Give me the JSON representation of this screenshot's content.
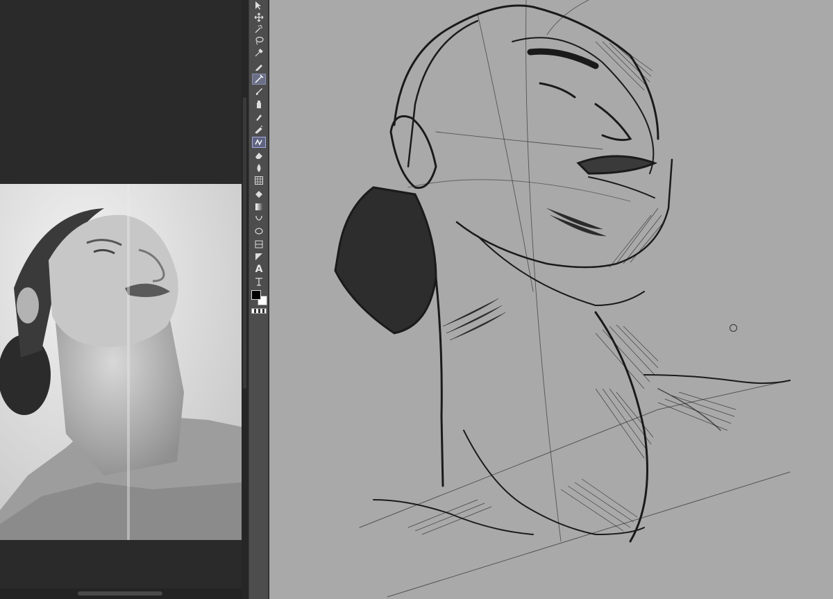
{
  "app": {
    "reference_panel": {
      "content": "reference-photo"
    },
    "tools": [
      {
        "id": "object-select",
        "icon": "arrow-select-icon"
      },
      {
        "id": "move",
        "icon": "move-icon"
      },
      {
        "id": "magic-wand",
        "icon": "magic-wand-icon"
      },
      {
        "id": "lasso",
        "icon": "lasso-icon"
      },
      {
        "id": "eyedropper",
        "icon": "eyedropper-icon"
      },
      {
        "id": "pen",
        "icon": "pen-icon"
      },
      {
        "id": "pencil",
        "icon": "pencil-icon",
        "active": true
      },
      {
        "id": "brush",
        "icon": "brush-icon"
      },
      {
        "id": "airbrush",
        "icon": "airbrush-icon"
      },
      {
        "id": "marker",
        "icon": "marker-icon"
      },
      {
        "id": "ink",
        "icon": "ink-icon"
      },
      {
        "id": "decoration",
        "icon": "decoration-icon",
        "active": true
      },
      {
        "id": "eraser",
        "icon": "eraser-icon"
      },
      {
        "id": "blend",
        "icon": "blend-drop-icon"
      },
      {
        "id": "perspective",
        "icon": "grid-ruler-icon"
      },
      {
        "id": "fill",
        "icon": "fill-bucket-icon"
      },
      {
        "id": "gradient",
        "icon": "gradient-icon"
      },
      {
        "id": "figure",
        "icon": "figure-icon"
      },
      {
        "id": "selection-lasso",
        "icon": "selection-lasso-icon"
      },
      {
        "id": "frame",
        "icon": "frame-icon"
      },
      {
        "id": "balloon",
        "icon": "balloon-icon"
      },
      {
        "id": "text",
        "icon": "text-icon",
        "label": "A"
      },
      {
        "id": "correct-line",
        "icon": "correct-line-icon"
      }
    ],
    "colors": {
      "foreground": "#000000",
      "background": "#ffffff",
      "canvas": "#a9a9a9",
      "toolbar": "#4d4d4d",
      "panel": "#2a2a2a",
      "active_tool": "#6a6f86"
    }
  }
}
